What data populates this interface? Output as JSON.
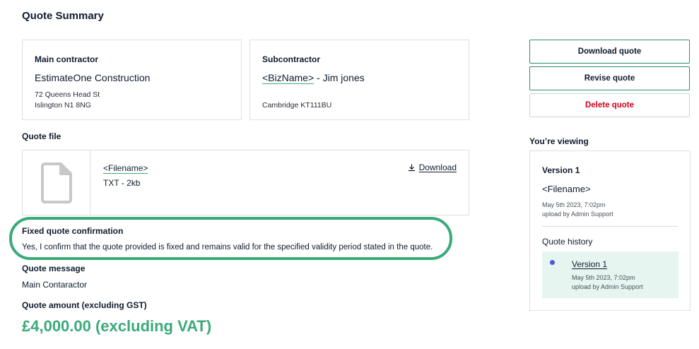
{
  "page": {
    "title": "Quote Summary"
  },
  "main_contractor": {
    "label": "Main contractor",
    "name": "EstimateOne Construction",
    "address_line1": "72 Queens Head St",
    "address_line2": "Islington N1 8NG"
  },
  "subcontractor": {
    "label": "Subcontractor",
    "biz_name": "<BizName>",
    "contact": " - Jim jones",
    "address": "Cambridge KT111BU"
  },
  "quote_file": {
    "heading": "Quote file",
    "filename": "<Filename>",
    "meta": "TXT - 2kb",
    "download_label": "Download",
    "icon": "document-icon"
  },
  "fixed_quote": {
    "heading": "Fixed quote confirmation",
    "text": "Yes, I confirm that the quote provided is fixed and remains valid for the specified validity period stated in the quote.",
    "highlight_color": "#3aaa7a"
  },
  "quote_message": {
    "heading": "Quote message",
    "text": "Main Contaractor"
  },
  "quote_amount": {
    "heading": "Quote amount (excluding GST)",
    "value": "£4,000.00 (excluding VAT)",
    "color": "#3aaa7a"
  },
  "actions": {
    "download": "Download quote",
    "revise": "Revise quote",
    "delete": "Delete quote",
    "delete_color": "#d0021b"
  },
  "viewer": {
    "label": "You’re viewing",
    "version": "Version 1",
    "filename": "<Filename>",
    "date": "May 5th 2023, 7:02pm",
    "uploaded_by": "upload by Admin Support",
    "history_label": "Quote history",
    "history": [
      {
        "version": "Version 1",
        "date": "May 5th 2023, 7:02pm",
        "uploaded_by": "upload by Admin Support"
      }
    ]
  }
}
